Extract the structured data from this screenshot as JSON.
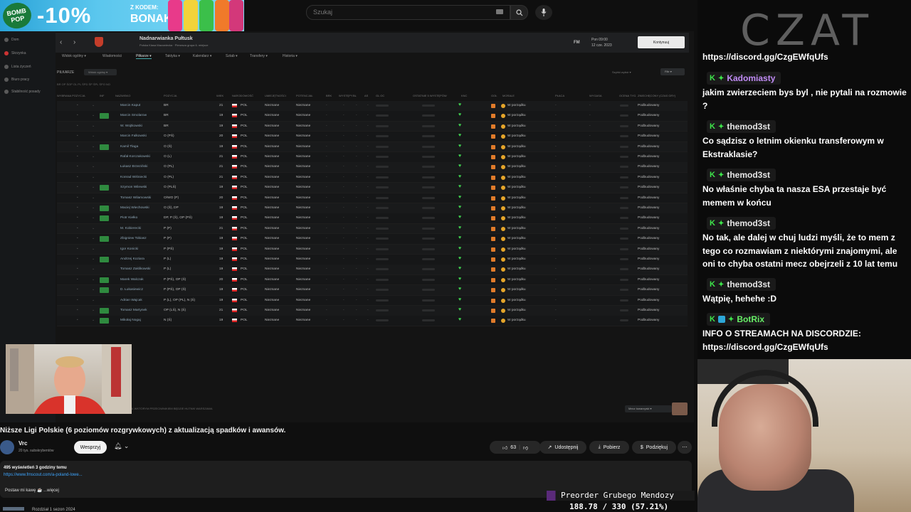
{
  "ad": {
    "logo": "BOMB POP",
    "discount": "-10%",
    "code_label": "Z KODEM:",
    "code": "BONAK"
  },
  "youtube": {
    "search_placeholder": "Szukaj"
  },
  "fm": {
    "sidebar": [
      "Dom",
      "Skrzynka",
      "Lista życzeń",
      "Biuro pracy",
      "Stabilność posady"
    ],
    "club_name": "Nadnarwianka Pułtusk",
    "club_sub": "Polska Klasa Mazowiecka · Pierwsza grupa 6. miejsce",
    "date_line1": "Pon 09:00",
    "date_line2": "12 cze. 2023",
    "fm_tag": "FM",
    "continue": "Kontynuuj",
    "menu": [
      "Widok ogólny ▾",
      "Wiadomości",
      "Piłkarze ▾",
      "Taktyka ▾",
      "Kalendarz ▾",
      "Sztab ▾",
      "Transfery ▾",
      "Historia ▾"
    ],
    "players_label": "PIŁKARZE",
    "view_select": "Widok ogólny ▾",
    "right_select": "Szybki wybór ▾",
    "filter": "Filtr ▾",
    "col_row": "BR  OP  ŚOP  OL  PL  ŚPD  ŚP  ŚPL  ŚPO  NO",
    "headers": [
      "WYBRANA POZYCJA",
      "INF",
      "NAZWISKO",
      "POZYCJA",
      "WIEK",
      "NARODOWOŚĆ",
      "UMIEJĘTNOŚCI",
      "POTENCJAŁ",
      "BRK",
      "WYSTĘPY",
      "BL",
      "AS",
      "GL OC",
      "OSTATNIE 5 WYSTĘPÓW",
      "KNC",
      "GOŁ",
      "MORALE",
      "PŁACA",
      "WYGASA",
      "OCENA TYG.",
      "ZNIECHĘCONY (CZAS GRY)"
    ],
    "players": [
      {
        "name": "Marcin Kaput",
        "pos": "BR",
        "age": "21"
      },
      {
        "name": "Marcin Smolarow",
        "pos": "BR",
        "age": "19"
      },
      {
        "name": "W. Wojtkowski",
        "pos": "BR",
        "age": "19"
      },
      {
        "name": "Marcin Falkowski",
        "pos": "O (PŚ)",
        "age": "20"
      },
      {
        "name": "Kamil Tłaga",
        "pos": "O (Ś)",
        "age": "19"
      },
      {
        "name": "Rafał Korczakowski",
        "pos": "O (L)",
        "age": "21"
      },
      {
        "name": "Łukasz Brzeziński",
        "pos": "O (PL)",
        "age": "21"
      },
      {
        "name": "Konrad Wiśniecki",
        "pos": "O (PL)",
        "age": "21"
      },
      {
        "name": "Szymon Wilewski",
        "pos": "O (PLŚ)",
        "age": "19"
      },
      {
        "name": "Tomasz Wilamowski",
        "pos": "O/WO (P)",
        "age": "20"
      },
      {
        "name": "Maciej Wiechowski",
        "pos": "O (Ś), DP",
        "age": "19"
      },
      {
        "name": "Piotr Kiełko",
        "pos": "DP, P (Ś), OP (PŚ)",
        "age": "19"
      },
      {
        "name": "M. Kobierecki",
        "pos": "P (P)",
        "age": "21"
      },
      {
        "name": "Zbigniew Tobiasz",
        "pos": "P (P)",
        "age": "19"
      },
      {
        "name": "Igor Konicki",
        "pos": "P (PŚ)",
        "age": "19"
      },
      {
        "name": "Andrzej Koziara",
        "pos": "P (L)",
        "age": "19"
      },
      {
        "name": "Tomasz Zaklikowski",
        "pos": "P (L)",
        "age": "19"
      },
      {
        "name": "Marek Walczak",
        "pos": "P (PŚ), OP (Ś)",
        "age": "20"
      },
      {
        "name": "D. Łukasiewicz",
        "pos": "P (PŚ), OP (Ś)",
        "age": "19"
      },
      {
        "name": "Adrian Wajcak",
        "pos": "P (L), OP (PL), N (Ś)",
        "age": "19"
      },
      {
        "name": "Tomasz Martynek",
        "pos": "OP (LŚ), N (Ś)",
        "age": "21"
      },
      {
        "name": "Mikołaj Nogaj",
        "pos": "N (Ś)",
        "age": "19"
      }
    ],
    "nat": "POL",
    "skill": "Nieznane",
    "potential": "Nieznane",
    "morale": "W porządku",
    "status": "Podbudowany",
    "dash": "-",
    "bottom_text": "CZŁ WKTORYM PRZECIWNIKIEM BĘDZIE HUTNIK WARSZAWA",
    "friendly": "Mecz towarzyski ▾"
  },
  "video": {
    "title": "Niższe Ligi Polskie (6 poziomów rozgrywkowych) z aktualizacją spadków i awansów.",
    "channel": "Vrc",
    "subs": "20 tys. subskrybentów",
    "support": "Wesprzyj",
    "likes": "63",
    "share": "Udostępnij",
    "download": "Pobierz",
    "thanks": "Podziękuj",
    "views": "495 wyświetleń  3 godziny temu",
    "link": "https://www.fmscout.com/a-poland-lowe...",
    "coffee": "Postaw mi kawę ☕ ...więcej",
    "bottom_item": "Rozdział 1 sezon 2024"
  },
  "chat": {
    "title": "CZAT",
    "messages": [
      {
        "text": "https://discord.gg/CzgEWfqUfs"
      },
      {
        "user": "Kadomiasty",
        "color": "#c08bf5",
        "text": "jakim zwierzeciem bys byl , nie pytali na rozmowie ?"
      },
      {
        "user": "themod3st",
        "color": "#e6e6e6",
        "text": "Co sądzisz o letnim okienku transferowym w Ekstraklasie?"
      },
      {
        "user": "themod3st",
        "color": "#e6e6e6",
        "text": "No właśnie chyba ta nasza ESA przestaje być memem w końcu"
      },
      {
        "user": "themod3st",
        "color": "#e6e6e6",
        "text": "No tak, ale dalej w chuj ludzi myśli, że to mem z tego co rozmawiam z niektórymi znajomymi, ale oni to chyba ostatni mecz obejrzeli z 10 lat temu"
      },
      {
        "user": "themod3st",
        "color": "#e6e6e6",
        "text": "Wątpię, hehehe :D"
      },
      {
        "user": "BotRix",
        "color": "#66ee66",
        "text": "INFO O STREAMACH NA DISCORDZIE: https://discord.gg/CzgEWfqUfs"
      }
    ]
  },
  "overlay": {
    "preorder": "Preorder Grubego Mendozy",
    "progress": "188.78 / 330 (57.21%)",
    "progress_value": 57.21
  }
}
